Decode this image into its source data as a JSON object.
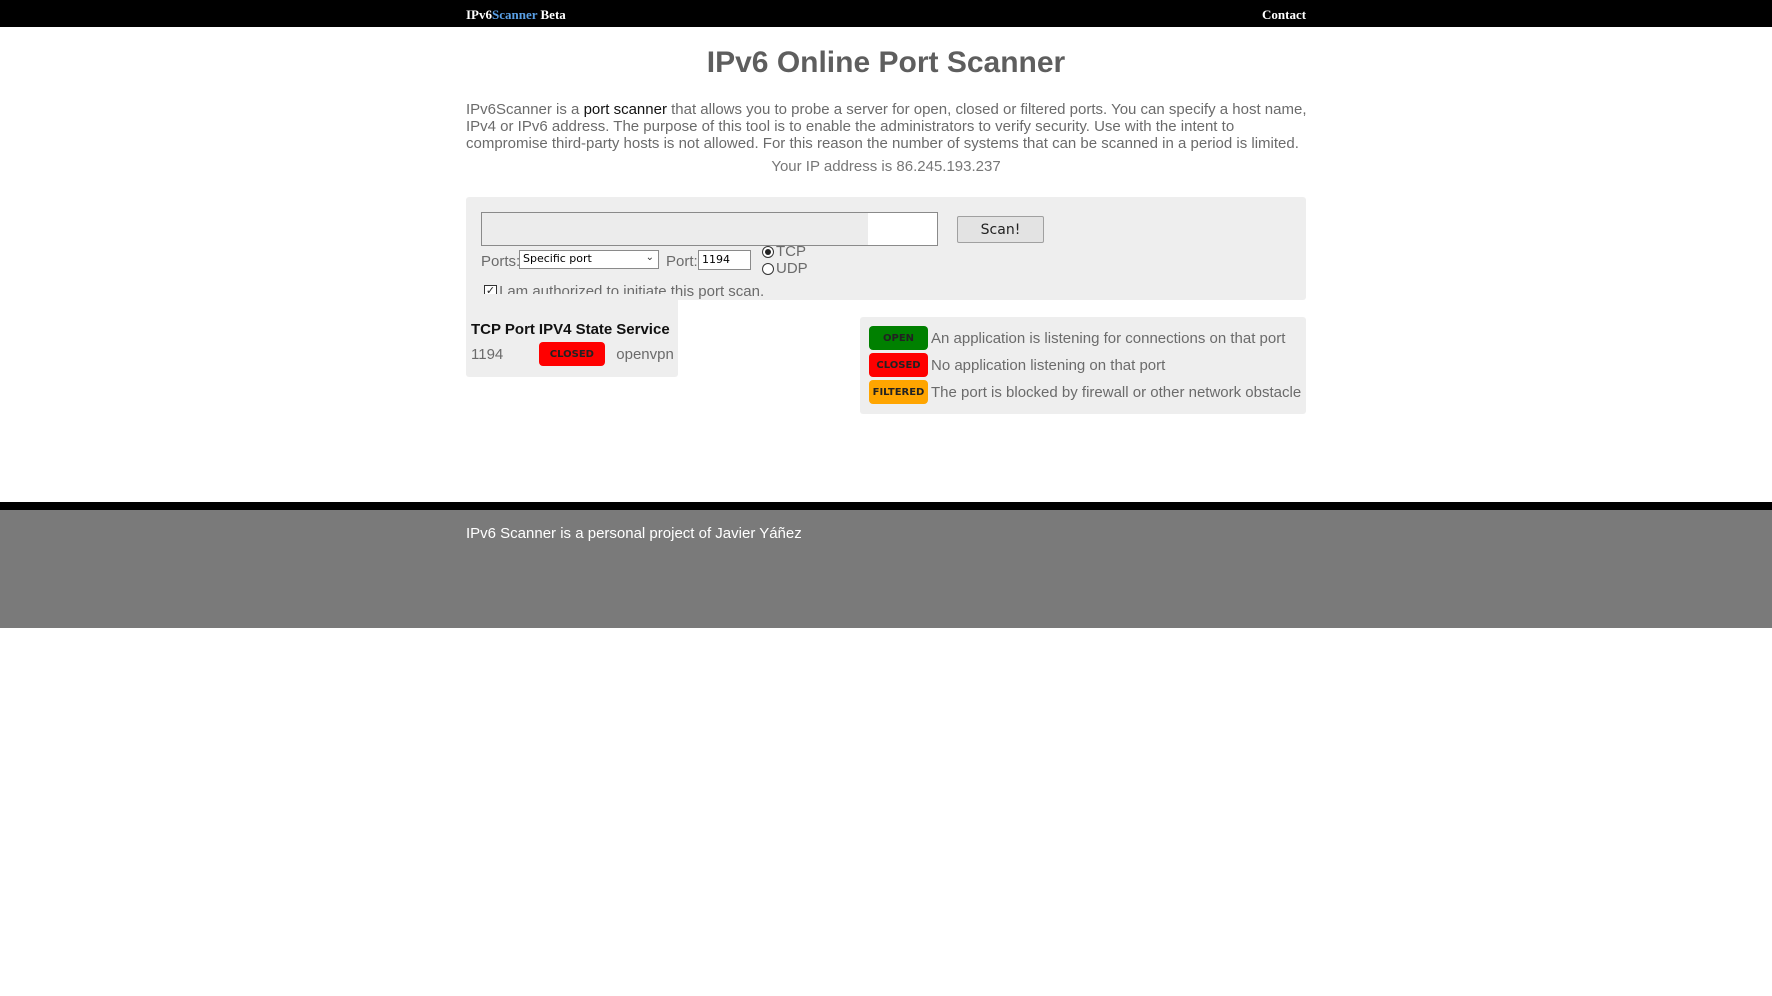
{
  "nav": {
    "brand_prefix": "IPv6",
    "brand_accent": "Scanner",
    "brand_suffix": " Beta",
    "contact": "Contact"
  },
  "page": {
    "title": "IPv6 Online Port Scanner",
    "intro_before": "IPv6Scanner is a ",
    "intro_highlight": "port scanner",
    "intro_after": " that allows you to probe a server for open, closed or filtered ports. You can specify a host name, IPv4 or IPv6 address. The purpose of this tool is to enable the administrators to verify security. Use with the intent to compromise third-party hosts is not allowed. For this reason the number of systems that can be scanned in a period is limited.",
    "your_ip": "Your IP address is 86.245.193.237"
  },
  "form": {
    "host_value": "",
    "scan_button": "Scan!",
    "ports_label": "Ports:",
    "ports_selected": "Specific port",
    "port_label": "Port:",
    "port_value": "1194",
    "protocol_tcp": "TCP",
    "protocol_udp": "UDP",
    "protocol_selected": "TCP",
    "authorized_label": "I am authorized to initiate this port scan.",
    "authorized_checked": true
  },
  "results": {
    "headers": [
      "TCP Port",
      "IPV4 State",
      "Service"
    ],
    "rows": [
      {
        "port": "1194",
        "state": "CLOSED",
        "service": "openvpn"
      }
    ]
  },
  "legend": [
    {
      "badge": "OPEN",
      "color": "#008000",
      "text": "An application is listening for connections on that port"
    },
    {
      "badge": "CLOSED",
      "color": "#ff0000",
      "text": "No application listening on that port"
    },
    {
      "badge": "FILTERED",
      "color": "#ffa500",
      "text": "The port is blocked by firewall or other network obstacle"
    }
  ],
  "footer": {
    "text": "IPv6 Scanner is a personal project of Javier Yáñez"
  },
  "colors": {
    "topbar": "#000000",
    "brand_accent": "#5aa0e6",
    "open": "#008000",
    "closed": "#ff0000",
    "filtered": "#ffa500",
    "footer": "#7a7a7a"
  }
}
